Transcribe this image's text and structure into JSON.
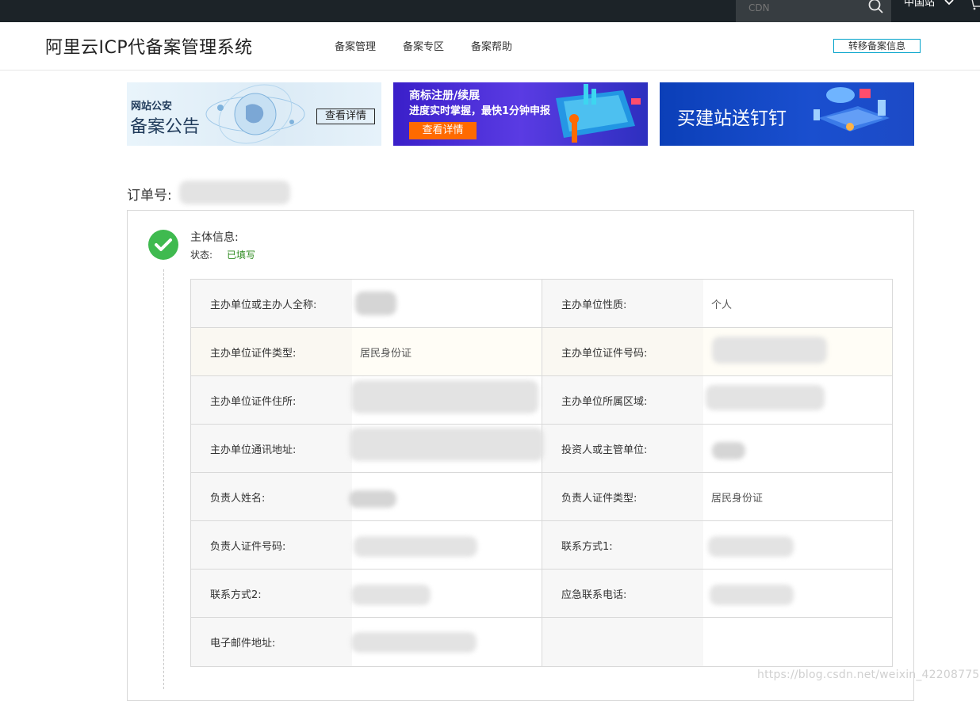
{
  "topbar": {
    "search_placeholder": "CDN",
    "region": "中国站"
  },
  "header": {
    "title": "阿里云ICP代备案管理系统",
    "nav": [
      "备案管理",
      "备案专区",
      "备案帮助"
    ],
    "transfer_button": "转移备案信息"
  },
  "banners": {
    "b1_small": "网站公安",
    "b1_big": "备案公告",
    "b1_button": "查看详情",
    "b2_title": "商标注册/续展",
    "b2_sub": "进度实时掌握，最快1分钟申报",
    "b2_button": "查看详情",
    "b3_text": "买建站送钉钉"
  },
  "order": {
    "label": "订单号:"
  },
  "section": {
    "title": "主体信息:",
    "status_label": "状态:",
    "status_value": "已填写"
  },
  "table": {
    "rows": [
      [
        {
          "label": "主办单位或主办人全称:",
          "value": ""
        },
        {
          "label": "主办单位性质:",
          "value": "个人"
        }
      ],
      [
        {
          "label": "主办单位证件类型:",
          "value": "居民身份证"
        },
        {
          "label": "主办单位证件号码:",
          "value": ""
        }
      ],
      [
        {
          "label": "主办单位证件住所:",
          "value": ""
        },
        {
          "label": "主办单位所属区域:",
          "value": ""
        }
      ],
      [
        {
          "label": "主办单位通讯地址:",
          "value": ""
        },
        {
          "label": "投资人或主管单位:",
          "value": ""
        }
      ],
      [
        {
          "label": "负责人姓名:",
          "value": ""
        },
        {
          "label": "负责人证件类型:",
          "value": "居民身份证"
        }
      ],
      [
        {
          "label": "负责人证件号码:",
          "value": ""
        },
        {
          "label": "联系方式1:",
          "value": ""
        }
      ],
      [
        {
          "label": "联系方式2:",
          "value": ""
        },
        {
          "label": "应急联系电话:",
          "value": ""
        }
      ],
      [
        {
          "label": "电子邮件地址:",
          "value": ""
        },
        {
          "label": "",
          "value": ""
        }
      ]
    ]
  },
  "watermark": "https://blog.csdn.net/weixin_42208775"
}
